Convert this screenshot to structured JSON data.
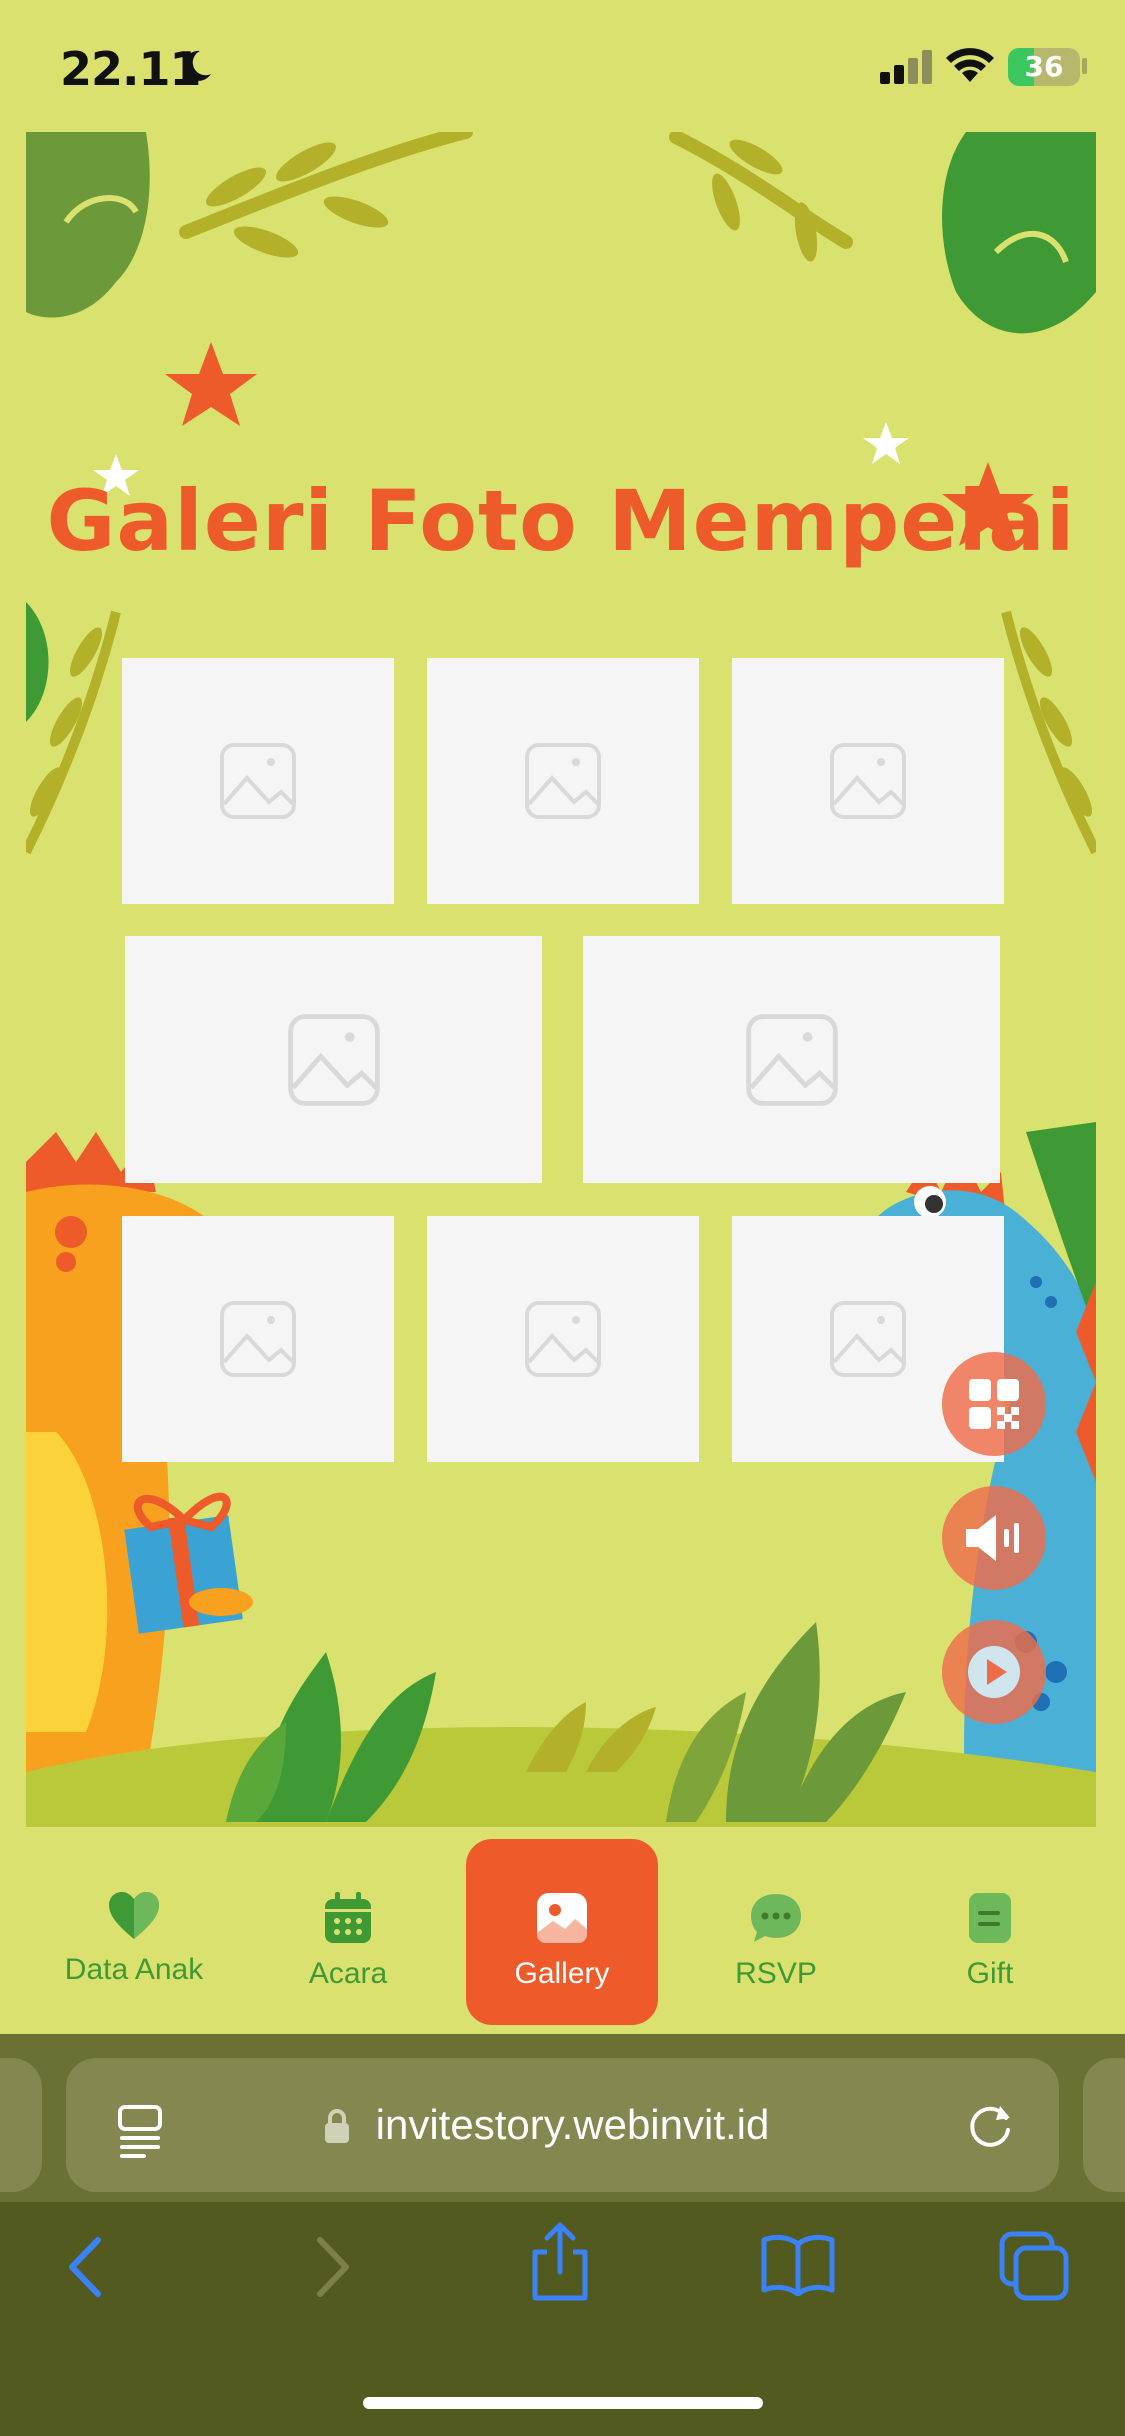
{
  "status_bar": {
    "time": "22.11",
    "battery": "36",
    "battery_level": 0.36
  },
  "page": {
    "title": "Galeri Foto Mempelai"
  },
  "gallery": {
    "photo_count": 8
  },
  "nav": {
    "items": [
      {
        "label": "Data Anak",
        "icon": "heart-icon"
      },
      {
        "label": "Acara",
        "icon": "calendar-icon"
      },
      {
        "label": "Gallery",
        "icon": "image-icon",
        "active": true
      },
      {
        "label": "RSVP",
        "icon": "chat-icon"
      },
      {
        "label": "Gift",
        "icon": "note-icon"
      }
    ]
  },
  "floating_buttons": [
    "qr-code-icon",
    "speaker-icon",
    "play-icon"
  ],
  "browser": {
    "url": "invitestory.webinvit.id"
  },
  "colors": {
    "background": "#dbe16f",
    "accent": "#ef5a2a",
    "nav_text": "#3f9a36",
    "browser_bar": "#525a20"
  }
}
